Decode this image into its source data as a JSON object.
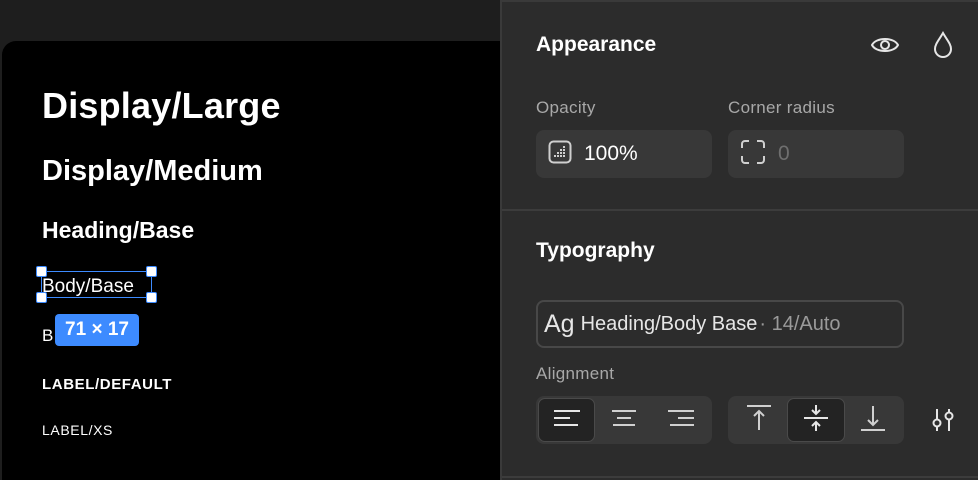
{
  "canvas": {
    "styles": [
      {
        "label": "Display/Large"
      },
      {
        "label": "Display/Medium"
      },
      {
        "label": "Heading/Base"
      },
      {
        "label": "Body/Base"
      },
      {
        "label": "B"
      },
      {
        "label": "LABEL/DEFAULT"
      },
      {
        "label": "LABEL/XS"
      }
    ],
    "selection_size": "71 × 17"
  },
  "appearance": {
    "title": "Appearance",
    "visibility_icon": "eye-icon",
    "fill_icon": "drop-icon",
    "opacity_label": "Opacity",
    "opacity_value": "100%",
    "corner_radius_label": "Corner radius",
    "corner_radius_value": "0"
  },
  "typography": {
    "title": "Typography",
    "preview_glyph": "Ag",
    "style_name": "Heading/Body Base",
    "style_meta": "· 14/Auto",
    "alignment_label": "Alignment",
    "horizontal_options": [
      "align-left",
      "align-center",
      "align-right"
    ],
    "horizontal_selected": "align-left",
    "vertical_options": [
      "align-top",
      "align-middle",
      "align-bottom"
    ],
    "vertical_selected": "align-middle",
    "settings_icon": "sliders-icon"
  },
  "colors": {
    "accent": "#3d8bff",
    "panel_bg": "#2c2c2c",
    "artboard_bg": "#000000"
  }
}
